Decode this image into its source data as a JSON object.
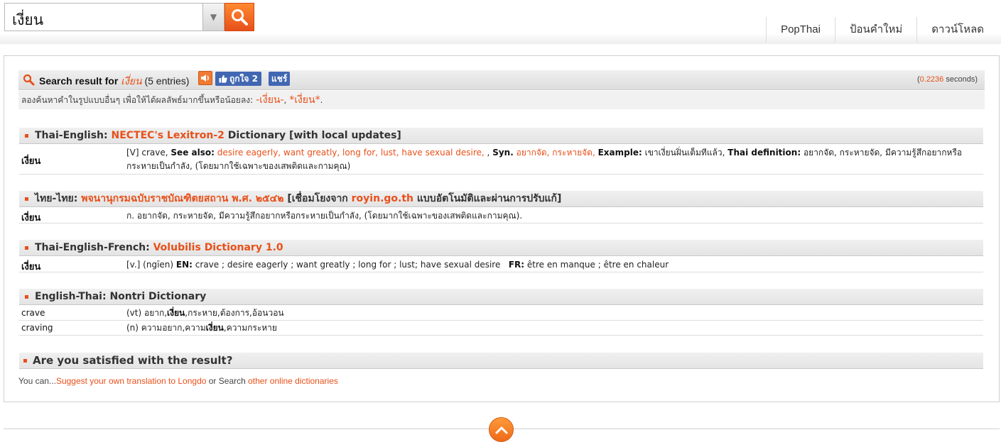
{
  "search": {
    "value": "เงี่ยน"
  },
  "nav": [
    {
      "label": "PopThai"
    },
    {
      "label": "ป้อนคำใหม่"
    },
    {
      "label": "ดาวน์โหลด"
    }
  ],
  "result": {
    "prefix": "Search result for",
    "query": "เงี่ยน",
    "entries": "(5 entries)",
    "like_label": "ถูกใจ 2",
    "share_label": "แชร์",
    "timing_open": "(",
    "timing_value": "0.2236",
    "timing_close": " seconds)"
  },
  "suggest": {
    "text": "ลองค้นหาคำในรูปแบบอื่นๆ เพื่อให้ได้ผลลัพธ์มากขึ้นหรือน้อยลง:",
    "alt1": "-เงี่ยน-",
    "sep": ",",
    "alt2": "*เงี่ยน*",
    "end": "."
  },
  "sections": {
    "lexitron": {
      "prefix": "Thai-English:",
      "name": "NECTEC's Lexitron-2",
      "suffix": "Dictionary [with local updates]",
      "word": "เงี่ยน",
      "pos": "[V] crave,",
      "see_also_label": "See also:",
      "see_also": "desire eagerly, want greatly, long for, lust, have sexual desire,",
      "comma": ",",
      "syn_label": "Syn.",
      "syn": "อยากจัด, กระหายจัด,",
      "example_label": "Example:",
      "example": "เขาเงี่ยนฝิ่นเต็มทีแล้ว,",
      "thai_def_label": "Thai definition:",
      "thai_def": "อยากจัด, กระหายจัด, มีความรู้สึกอยากหรือกระหายเป็นกำลัง, (โดยมากใช้เฉพาะของเสพติดและกามคุณ)"
    },
    "royin": {
      "prefix": "ไทย-ไทย:",
      "name": "พจนานุกรมฉบับราชบัณฑิตยสถาน พ.ศ. ๒๕๔๒",
      "mid": "[เชื่อมโยงจาก",
      "link": "royin.go.th",
      "suffix": "แบบอัตโนมัติและผ่านการปรับแก้]",
      "word": "เงี่ยน",
      "definition": "ก. อยากจัด, กระหายจัด, มีความรู้สึกอยากหรือกระหายเป็นกำลัง, (โดยมากใช้เฉพาะของเสพติดและกามคุณ)."
    },
    "volubilis": {
      "prefix": "Thai-English-French:",
      "name": "Volubilis Dictionary 1.0",
      "word": "เงี่ยน",
      "pos": "[v.] (ngīen)",
      "en_label": "EN:",
      "en": "crave ; desire eagerly ; want greatly ; long for ; lust; have sexual desire",
      "fr_label": "FR:",
      "fr": "être en manque ; être en chaleur"
    },
    "nontri": {
      "title": "English-Thai: Nontri Dictionary",
      "rows": [
        {
          "word": "crave",
          "a": "(vt) อยาก,",
          "b": "เงี่ยน",
          "c": ",กระหาย,ต้องการ,อ้อนวอน"
        },
        {
          "word": "craving",
          "a": "(n) ความอยาก,ความ",
          "b": "เงี่ยน",
          "c": ",ความกระหาย"
        }
      ]
    }
  },
  "satisfied": {
    "title": "Are you satisfied with the result?",
    "lead": "You can...",
    "suggest_link": "Suggest your own translation to Longdo",
    "mid": " or Search ",
    "other_link": "other online dictionaries"
  },
  "colors": {
    "accent": "#e8501a",
    "facebook": "#4267b2"
  }
}
